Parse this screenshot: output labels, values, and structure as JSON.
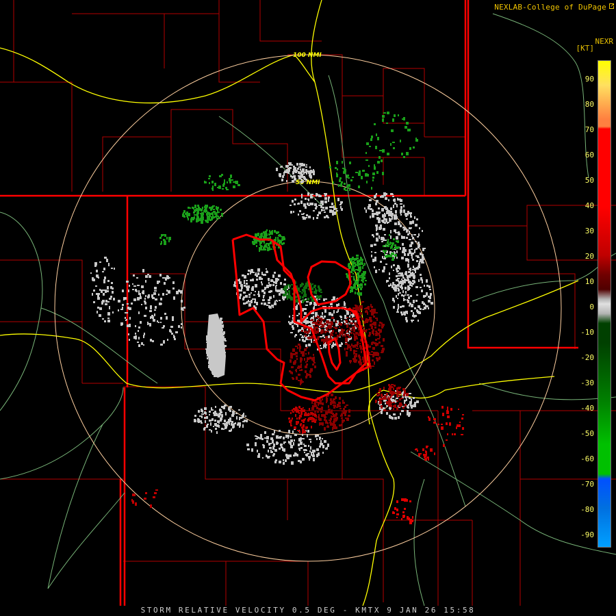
{
  "header": {
    "credit": "NEXLAB-College of DuPage",
    "credit_icon": "launch-icon",
    "product": "NEXR",
    "units": "[KT]"
  },
  "legend": {
    "ticks": [
      "90",
      "80",
      "70",
      "60",
      "50",
      "40",
      "30",
      "20",
      "10",
      "0",
      "-10",
      "-20",
      "-30",
      "-40",
      "-50",
      "-60",
      "-70",
      "-80",
      "-90"
    ],
    "colors": {
      "plus_high": "#ffff00",
      "plus_mid": "#ff8040",
      "plus_red": "#ff0000",
      "plus_dark": "#700000",
      "zero": "#b4b4b4",
      "minus_green": "#00c000",
      "minus_dark": "#004000",
      "minus_blue": "#0050ff",
      "minus_light_blue": "#00a0ff"
    }
  },
  "map": {
    "ring_labels": [
      "100 NMI",
      "50 NMI"
    ],
    "colors": {
      "state_border": "#ff0000",
      "county_border": "#b40000",
      "highway": "#ffff00",
      "river": "#78b478",
      "range_ring": "#ffd0a0",
      "warning_polygon": "#ff0000"
    }
  },
  "footer": {
    "caption": "STORM RELATIVE VELOCITY 0.5 DEG - KMTX 9 JAN 26 15:58"
  }
}
